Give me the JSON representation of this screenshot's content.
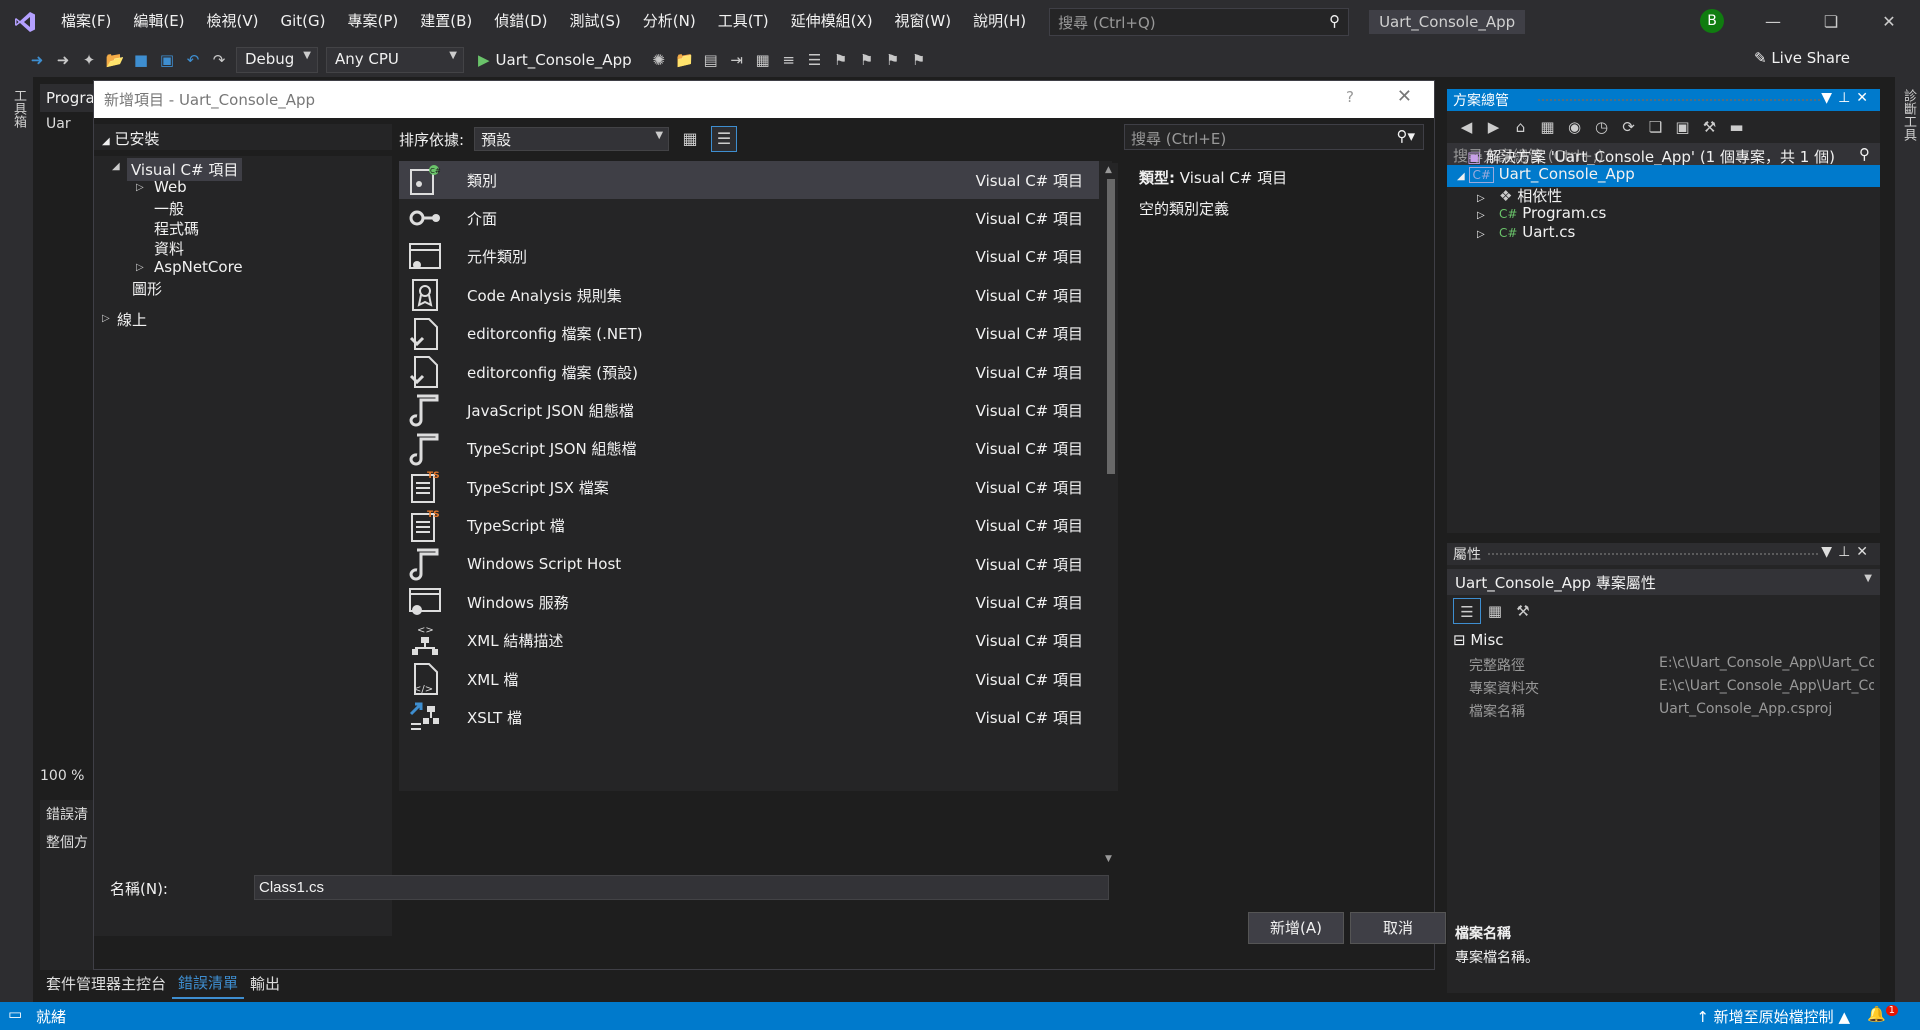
{
  "menubar": {
    "items": [
      "檔案(F)",
      "編輯(E)",
      "檢視(V)",
      "Git(G)",
      "專案(P)",
      "建置(B)",
      "偵錯(D)",
      "測試(S)",
      "分析(N)",
      "工具(T)",
      "延伸模組(X)",
      "視窗(W)",
      "說明(H)"
    ],
    "search_placeholder": "搜尋 (Ctrl+Q)",
    "project_title": "Uart_Console_App",
    "avatar_letter": "B"
  },
  "toolbar": {
    "config": "Debug",
    "platform": "Any CPU",
    "run_label": "Uart_Console_App",
    "live_share": "Live Share"
  },
  "left_rail": {
    "label": "工具箱"
  },
  "right_rail": {
    "label": "診斷工具"
  },
  "editor": {
    "tab_label": "Progra",
    "nav_label": "Uar",
    "zoom": "100 %",
    "error_list_title": "錯誤清",
    "error_list_scope": "整個方"
  },
  "bottom_tabs": [
    "套件管理器主控台",
    "錯誤清單",
    "輸出"
  ],
  "status": {
    "ready": "就緒",
    "source_control": "新增至原始檔控制",
    "notifications": "1"
  },
  "dialog": {
    "title": "新增項目 - Uart_Console_App",
    "help": "?",
    "installed_header": "已安裝",
    "tree": {
      "root": "Visual C# 項目",
      "web": "Web",
      "general": "一般",
      "code": "程式碼",
      "data": "資料",
      "aspnetcore": "AspNetCore",
      "graphics": "圖形",
      "online": "線上"
    },
    "sort_label": "排序依據:",
    "sort_value": "預設",
    "search_placeholder": "搜尋 (Ctrl+E)",
    "templates": [
      {
        "name": "類別",
        "type": "Visual C# 項目",
        "icon": "class-icon"
      },
      {
        "name": "介面",
        "type": "Visual C# 項目",
        "icon": "interface-icon"
      },
      {
        "name": "元件類別",
        "type": "Visual C# 項目",
        "icon": "component-class-icon"
      },
      {
        "name": "Code Analysis 規則集",
        "type": "Visual C# 項目",
        "icon": "ruleset-icon"
      },
      {
        "name": "editorconfig 檔案 (.NET)",
        "type": "Visual C# 項目",
        "icon": "editorconfig-icon"
      },
      {
        "name": "editorconfig 檔案 (預設)",
        "type": "Visual C# 項目",
        "icon": "editorconfig-icon"
      },
      {
        "name": "JavaScript JSON 組態檔",
        "type": "Visual C# 項目",
        "icon": "script-icon"
      },
      {
        "name": "TypeScript JSON 組態檔",
        "type": "Visual C# 項目",
        "icon": "script-icon"
      },
      {
        "name": "TypeScript JSX 檔案",
        "type": "Visual C# 項目",
        "icon": "typescript-file-icon"
      },
      {
        "name": "TypeScript 檔",
        "type": "Visual C# 項目",
        "icon": "typescript-file-icon"
      },
      {
        "name": "Windows Script Host",
        "type": "Visual C# 項目",
        "icon": "script-icon"
      },
      {
        "name": "Windows 服務",
        "type": "Visual C# 項目",
        "icon": "windows-service-icon"
      },
      {
        "name": "XML 結構描述",
        "type": "Visual C# 項目",
        "icon": "xml-schema-icon"
      },
      {
        "name": "XML 檔",
        "type": "Visual C# 項目",
        "icon": "xml-file-icon"
      },
      {
        "name": "XSLT 檔",
        "type": "Visual C# 項目",
        "icon": "xslt-icon"
      }
    ],
    "detail": {
      "type_label": "類型:",
      "type_value": "Visual C# 項目",
      "description": "空的類別定義"
    },
    "name_label": "名稱(N):",
    "name_value": "Class1.cs",
    "add_button": "新增(A)",
    "cancel_button": "取消"
  },
  "solution_explorer": {
    "title": "方案總管",
    "search_placeholder": "搜尋方案總管 (Ctrl+;)",
    "solution": "解決方案 'Uart_Console_App' (1 個專案，共 1 個)",
    "project": "Uart_Console_App",
    "items": [
      "相依性",
      "Program.cs",
      "Uart.cs"
    ]
  },
  "properties": {
    "title": "屬性",
    "object": "Uart_Console_App  專案屬性",
    "category": "Misc",
    "rows": [
      {
        "key": "完整路徑",
        "value": "E:\\c\\Uart_Console_App\\Uart_Co"
      },
      {
        "key": "專案資料夾",
        "value": "E:\\c\\Uart_Console_App\\Uart_Co"
      },
      {
        "key": "檔案名稱",
        "value": "Uart_Console_App.csproj"
      }
    ],
    "desc_title": "檔案名稱",
    "desc_text": "專案檔名稱。"
  }
}
